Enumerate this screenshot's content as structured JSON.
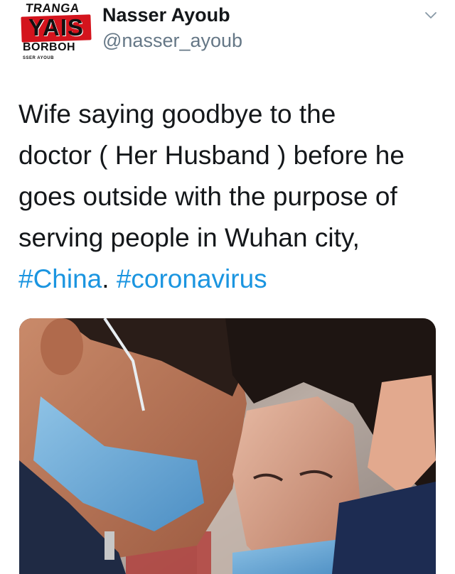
{
  "author": {
    "display_name": "Nasser Ayoub",
    "handle": "@nasser_ayoub",
    "avatar_text": {
      "top": "TRANGA",
      "middle": "YAIS",
      "bottom": "BORBOH",
      "tiny": "SSER AYOUB"
    }
  },
  "tweet": {
    "lines": [
      "Wife saying goodbye to the",
      "doctor ( Her Husband ) before he",
      "goes outside with the purpose of",
      "serving people in Wuhan city,"
    ],
    "hashtag_1": "#China",
    "separator": ". ",
    "hashtag_2": "#coronavirus"
  },
  "icons": {
    "menu": "chevron-down-icon"
  },
  "colors": {
    "hashtag": "#1b95e0",
    "handle": "#657786",
    "text": "#14171a"
  }
}
